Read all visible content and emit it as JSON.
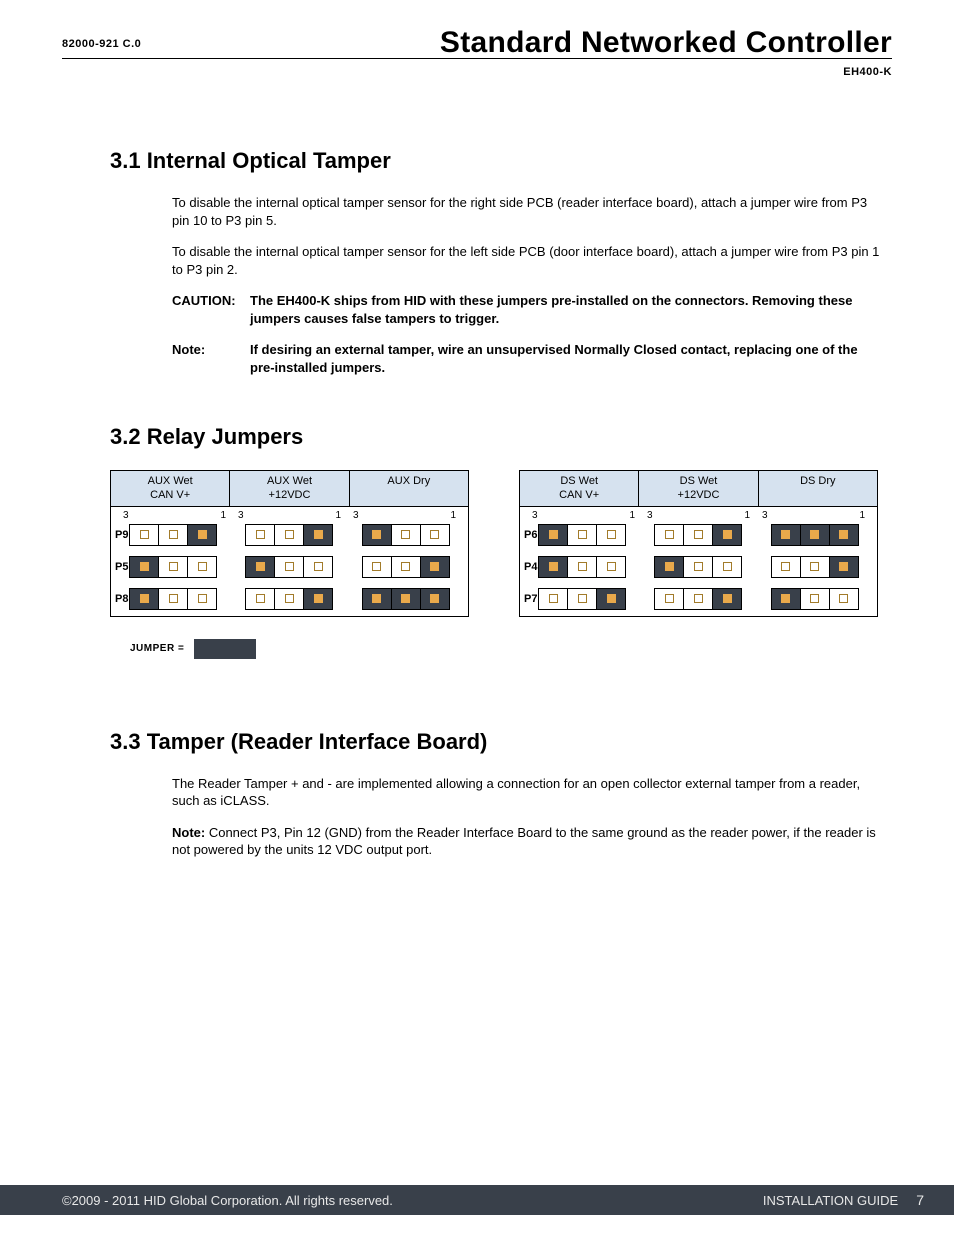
{
  "header": {
    "docnum": "82000-921 C.0",
    "title": "Standard Networked Controller",
    "model": "EH400-K"
  },
  "sections": {
    "s1": {
      "heading": "3.1  Internal Optical Tamper",
      "p1": "To disable the internal optical tamper sensor for the right side PCB (reader interface board), attach a jumper wire from P3 pin 10 to P3 pin 5.",
      "p2": "To disable the internal optical tamper sensor for the left side PCB (door interface board), attach a jumper wire from P3 pin 1 to P3 pin 2.",
      "cautionLabel": "CAUTION:",
      "cautionText": "The EH400-K ships from HID with these jumpers pre-installed on the connectors. Removing these jumpers causes false tampers to trigger.",
      "noteLabel": "Note:",
      "noteText": "If desiring an external tamper, wire an unsupervised Normally Closed contact, replacing one of the pre-installed jumpers."
    },
    "s2": {
      "heading": "3.2  Relay Jumpers",
      "legendLabel": "JUMPER =",
      "pinLeft": "3",
      "pinRight": "1",
      "left": {
        "cols": [
          {
            "l1": "AUX Wet",
            "l2": "CAN V+"
          },
          {
            "l1": "AUX Wet",
            "l2": "+12VDC"
          },
          {
            "l1": "AUX Dry",
            "l2": ""
          }
        ],
        "rows": [
          {
            "label": "P9",
            "cells": [
              [
                0,
                0,
                1
              ],
              [
                0,
                0,
                1
              ],
              [
                1,
                0,
                0
              ]
            ]
          },
          {
            "label": "P5",
            "cells": [
              [
                1,
                0,
                0
              ],
              [
                1,
                0,
                0
              ],
              [
                0,
                0,
                1
              ]
            ]
          },
          {
            "label": "P8",
            "cells": [
              [
                1,
                0,
                0
              ],
              [
                0,
                0,
                1
              ],
              [
                1,
                1,
                1
              ]
            ]
          }
        ]
      },
      "right": {
        "cols": [
          {
            "l1": "DS Wet",
            "l2": "CAN V+"
          },
          {
            "l1": "DS Wet",
            "l2": "+12VDC"
          },
          {
            "l1": "DS Dry",
            "l2": ""
          }
        ],
        "rows": [
          {
            "label": "P6",
            "cells": [
              [
                1,
                0,
                0
              ],
              [
                0,
                0,
                1
              ],
              [
                1,
                1,
                1
              ]
            ]
          },
          {
            "label": "P4",
            "cells": [
              [
                1,
                0,
                0
              ],
              [
                1,
                0,
                0
              ],
              [
                0,
                0,
                1
              ]
            ]
          },
          {
            "label": "P7",
            "cells": [
              [
                0,
                0,
                1
              ],
              [
                0,
                0,
                1
              ],
              [
                1,
                0,
                0
              ]
            ]
          }
        ]
      }
    },
    "s3": {
      "heading": "3.3  Tamper (Reader Interface Board)",
      "p1": "The Reader Tamper + and - are implemented allowing a connection for an open collector external tamper from a reader, such as iCLASS.",
      "noteBold": "Note:",
      "p2": " Connect P3, Pin 12 (GND) from the Reader Interface Board to the same ground as the reader power, if the reader is not powered by the units 12 VDC output port."
    }
  },
  "footer": {
    "copyright": "©2009 - 2011 HID Global Corporation. All rights reserved.",
    "guide": "INSTALLATION GUIDE",
    "page": "7"
  }
}
